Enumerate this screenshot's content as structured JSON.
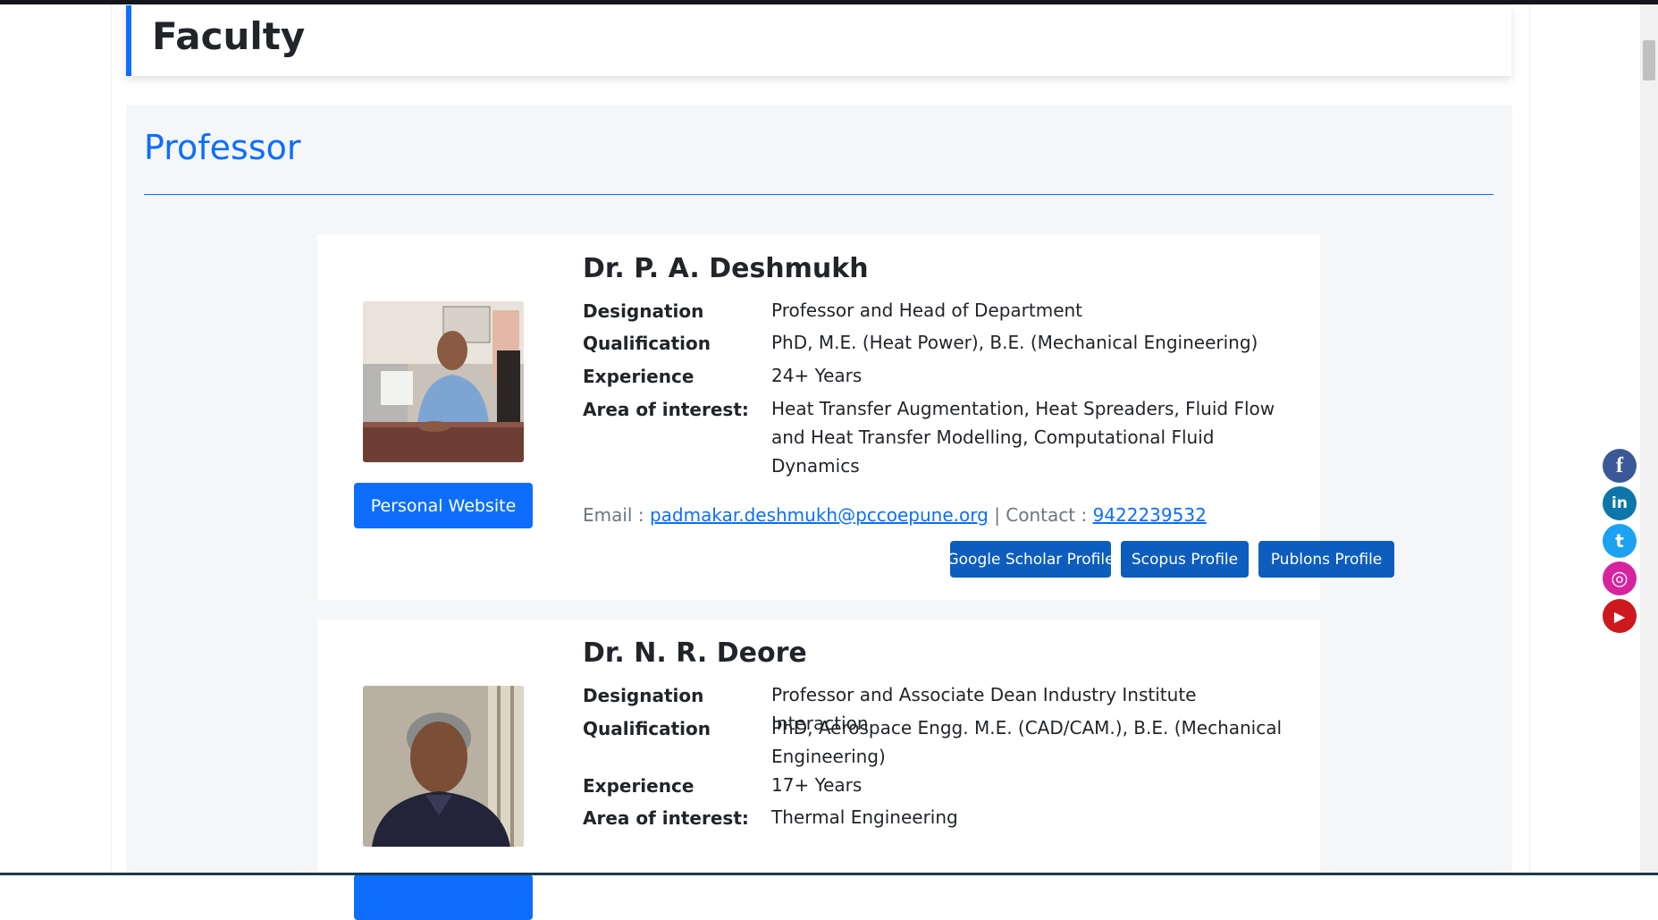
{
  "page": {
    "title": "Faculty"
  },
  "section": {
    "title": "Professor"
  },
  "faculty": [
    {
      "name": "Dr. P. A. Deshmukh",
      "website_label": "Personal Website",
      "fields": [
        {
          "label": "Designation",
          "value": "Professor and Head of Department"
        },
        {
          "label": "Qualification",
          "value": "PhD, M.E. (Heat Power), B.E. (Mechanical Engineering)"
        },
        {
          "label": "Experience",
          "value": "24+ Years"
        },
        {
          "label": "Area of interest:",
          "value": "Heat Transfer Augmentation, Heat Spreaders, Fluid Flow and Heat Transfer Modelling, Computational Fluid Dynamics"
        }
      ],
      "email_label": "Email :",
      "email": "padmakar.deshmukh@pccoepune.org",
      "contact_label": "| Contact :",
      "contact": "9422239532",
      "profiles": [
        "Google Scholar Profile",
        "Scopus Profile",
        "Publons Profile"
      ]
    },
    {
      "name": "Dr. N. R. Deore",
      "website_label": "",
      "fields": [
        {
          "label": "Designation",
          "value": "Professor and Associate Dean Industry Institute Interaction"
        },
        {
          "label": "Qualification",
          "value": "PhD, Aerospace Engg. M.E. (CAD/CAM.), B.E. (Mechanical Engineering)"
        },
        {
          "label": "Experience",
          "value": "17+ Years"
        },
        {
          "label": "Area of interest:",
          "value": "Thermal Engineering"
        }
      ]
    }
  ],
  "social": [
    {
      "name": "facebook",
      "glyph": "f",
      "color": "#3b5998"
    },
    {
      "name": "linkedin",
      "glyph": "in",
      "color": "#0e76a8"
    },
    {
      "name": "twitter",
      "glyph": "t",
      "color": "#1da1f2"
    },
    {
      "name": "instagram",
      "glyph": "◎",
      "color": "#d6249f"
    },
    {
      "name": "youtube",
      "glyph": "▶",
      "color": "#cc181e"
    }
  ]
}
